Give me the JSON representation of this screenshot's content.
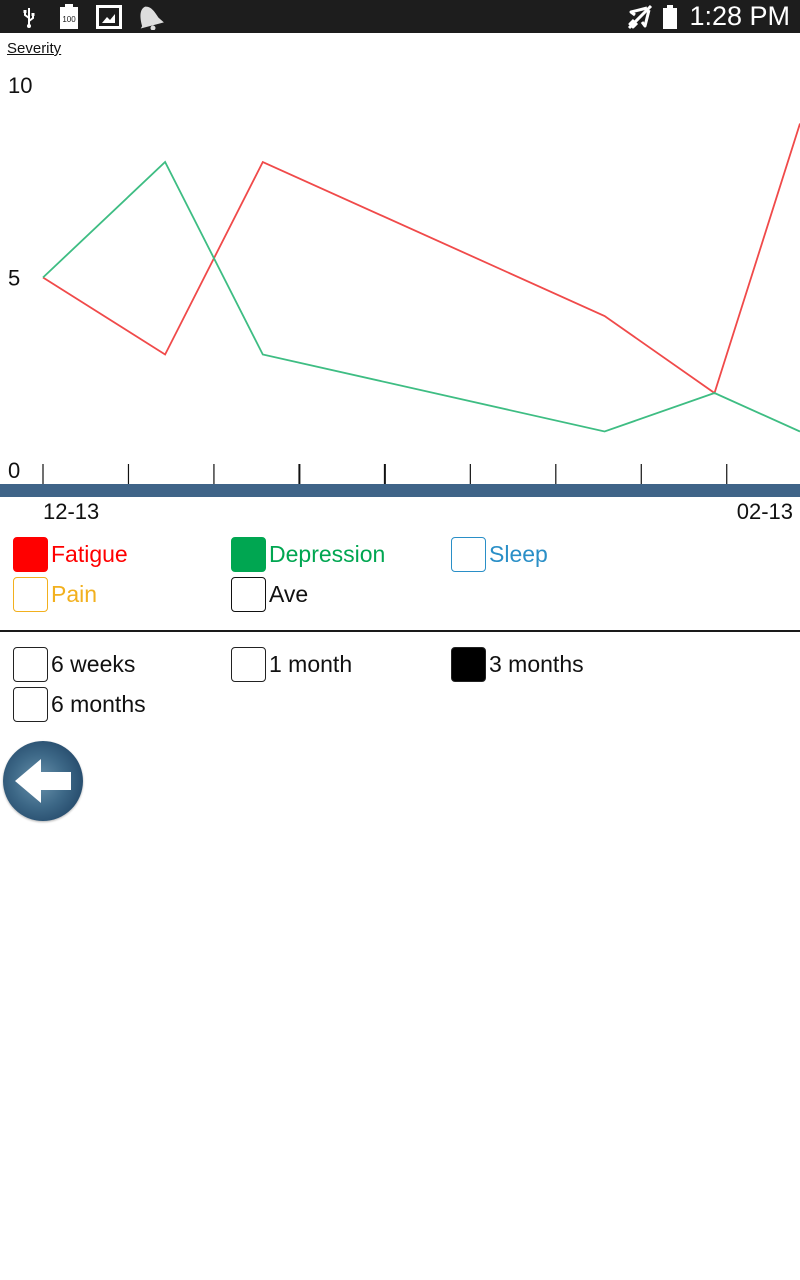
{
  "status_bar": {
    "left_icons": [
      "usb-icon",
      "battery-100-icon",
      "gallery-icon",
      "notification-bell-icon"
    ],
    "battery_text": "100",
    "right_icons": [
      "airplane-mode-icon",
      "battery-icon"
    ],
    "time": "1:28 PM"
  },
  "chart_header": {
    "y_title": "Severity"
  },
  "chart_data": {
    "type": "line",
    "title": "",
    "ylabel": "Severity",
    "xlabel": "",
    "ylim": [
      0,
      10
    ],
    "y_ticks": [
      "0",
      "5",
      "10"
    ],
    "x_start_label": "12-13",
    "x_end_label": "02-13",
    "x_range_days": [
      0,
      62
    ],
    "x_tick_count": 9,
    "x_tick_interval_days": 7,
    "grid": false,
    "series": [
      {
        "name": "Fatigue",
        "color": "#f04a4a",
        "x": [
          0,
          10,
          18,
          46,
          55,
          62
        ],
        "values": [
          5,
          3,
          8,
          4,
          2,
          9
        ]
      },
      {
        "name": "Depression",
        "color": "#3ebd83",
        "x": [
          0,
          10,
          18,
          46,
          55,
          62
        ],
        "values": [
          5,
          8,
          3,
          1,
          2,
          1
        ]
      }
    ]
  },
  "legend": {
    "items": [
      {
        "label": "Fatigue",
        "color": "#ff0000",
        "checked": true
      },
      {
        "label": "Depression",
        "color": "#00a651",
        "checked": true
      },
      {
        "label": "Sleep",
        "color": "#2a8fc7",
        "checked": false
      },
      {
        "label": "Pain",
        "color": "#f2b01e",
        "checked": false
      },
      {
        "label": "Ave",
        "color": "#111111",
        "checked": false
      }
    ]
  },
  "range_options": {
    "items": [
      {
        "label": "6 weeks",
        "checked": false
      },
      {
        "label": "1 month",
        "checked": false
      },
      {
        "label": "3 months",
        "checked": true
      },
      {
        "label": "6 months",
        "checked": false
      }
    ]
  },
  "colors": {
    "axis_bar": "#3f6488",
    "status_bar_bg": "#1d1d1d"
  },
  "back_button": {
    "icon": "back-arrow-icon"
  }
}
